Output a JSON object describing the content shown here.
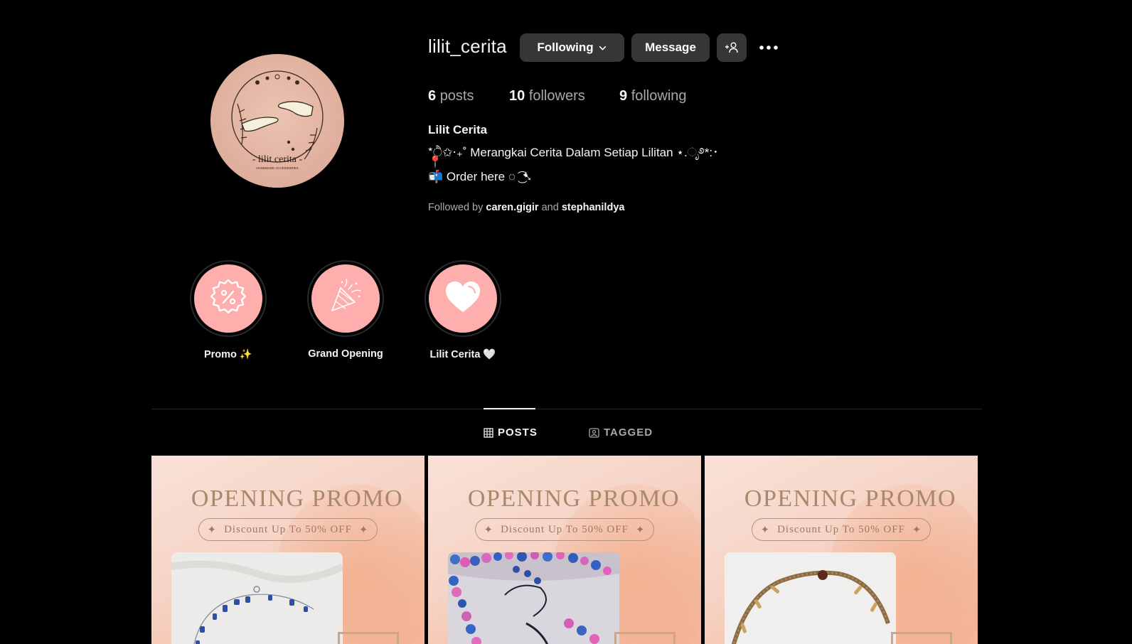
{
  "profile": {
    "username": "lilit_cerita",
    "following_label": "Following",
    "message_label": "Message",
    "avatar_text": "- lilit cerita -",
    "avatar_subtext": "HANDMADE ACCESSORIES",
    "stats": {
      "posts_count": "6",
      "posts_label": "posts",
      "followers_count": "10",
      "followers_label": "followers",
      "following_count": "9",
      "following_label": "following"
    },
    "full_name": "Lilit Cerita",
    "bio_line1": "*ੈ✩‧₊˚ Merangkai Cerita Dalam Setiap Lilitan ⋆.ೃ࿔*:･",
    "bio_line2": "📍",
    "bio_line3": "📬 Order here ◌ ͜͡ ➷",
    "followed_by_prefix": "Followed by",
    "followed_by_user1": "caren.gigir",
    "followed_by_and": "and",
    "followed_by_user2": "stephanildya"
  },
  "highlights": [
    {
      "label": "Promo ✨",
      "icon": "percent-badge-icon"
    },
    {
      "label": "Grand Opening",
      "icon": "party-popper-icon"
    },
    {
      "label": "Lilit Cerita 🤍",
      "icon": "heart-icon"
    }
  ],
  "tabs": {
    "posts": "POSTS",
    "tagged": "TAGGED"
  },
  "posts": [
    {
      "title": "OPENING PROMO",
      "subtitle": "Discount Up To 50% OFF"
    },
    {
      "title": "OPENING PROMO",
      "subtitle": "Discount Up To 50% OFF"
    },
    {
      "title": "OPENING PROMO",
      "subtitle": "Discount Up To 50% OFF"
    }
  ],
  "colors": {
    "background": "#000000",
    "button": "#363636",
    "highlight": "#ffaeae",
    "muted_text": "#a8a8a8"
  }
}
